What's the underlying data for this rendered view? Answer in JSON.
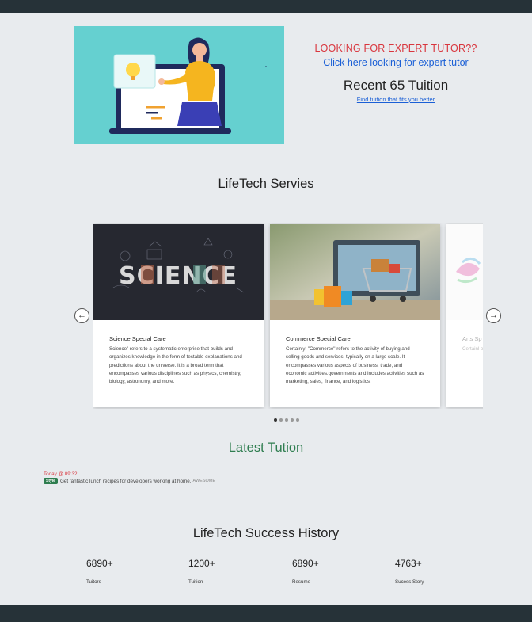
{
  "hero": {
    "cta_title": "LOOKING FOR EXPERT TUTOR??",
    "cta_link": "Click here looking for expert tutor",
    "recent": "Recent 65 Tuition",
    "fit_link": "Find tuition that fits you better"
  },
  "services": {
    "title": "LifeTech Servies",
    "cards": [
      {
        "title": "Science Special Care",
        "text": "Science\" refers to a systematic enterprise that builds and organizes knowledge in the form of testable explanations and predictions about the universe. It is a broad term that encompasses various disciplines such as physics, chemistry, biology, astronomy, and more.",
        "image_word": "SCIENCE"
      },
      {
        "title": "Commerce Special Care",
        "text": "Certainly! \"Commerce\" refers to the activity of buying and selling goods and services, typically on a large scale. It encompasses various aspects of business, trade, and economic activities.governments and includes activities such as marketing, sales, finance, and logistics."
      },
      {
        "title": "Arts Sp",
        "text": "Certainl encompa products subcateg that enco"
      }
    ],
    "prev_icon": "arrow-left-icon",
    "next_icon": "arrow-right-icon",
    "dots_count": 5,
    "active_dot": 1
  },
  "latest": {
    "title": "Latest Tution",
    "time": "Today @ 09:32",
    "badge": "Style",
    "text": "Get fantastic lunch recipes for developers working at home.",
    "tag": "AWESOME"
  },
  "history": {
    "title": "LifeTech Success History",
    "stats": [
      {
        "value": "6890+",
        "label": "Tuitors"
      },
      {
        "value": "1200+",
        "label": "Tuition"
      },
      {
        "value": "6890+",
        "label": "Resume"
      },
      {
        "value": "4763+",
        "label": "Sucess Story"
      }
    ]
  },
  "colors": {
    "dark_bar": "#263238",
    "accent_red": "#d9363e",
    "link_blue": "#1a5fd6",
    "green": "#2e7d4f",
    "hero_bg": "#65d0d0"
  }
}
